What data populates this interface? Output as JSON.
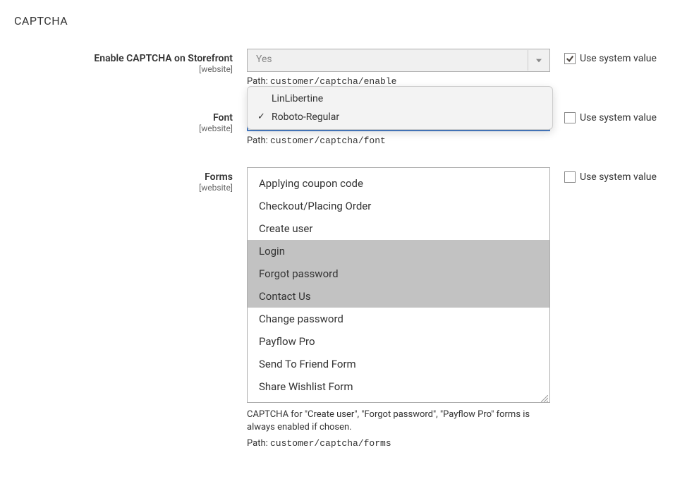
{
  "section": {
    "title": "CAPTCHA"
  },
  "fields": {
    "enable": {
      "label": "Enable CAPTCHA on Storefront",
      "scope": "[website]",
      "value": "Yes",
      "path_label": "Path: ",
      "path_value": "customer/captcha/enable",
      "use_system": true,
      "use_system_label": "Use system value"
    },
    "font": {
      "label": "Font",
      "scope": "[website]",
      "options": [
        {
          "label": "LinLibertine",
          "selected": false
        },
        {
          "label": "Roboto-Regular",
          "selected": true
        }
      ],
      "path_label": "Path: ",
      "path_value": "customer/captcha/font",
      "use_system": false,
      "use_system_label": "Use system value"
    },
    "forms": {
      "label": "Forms",
      "scope": "[website]",
      "options": [
        {
          "label": "Applying coupon code",
          "selected": false
        },
        {
          "label": "Checkout/Placing Order",
          "selected": false
        },
        {
          "label": "Create user",
          "selected": false
        },
        {
          "label": "Login",
          "selected": true
        },
        {
          "label": "Forgot password",
          "selected": true
        },
        {
          "label": "Contact Us",
          "selected": true
        },
        {
          "label": "Change password",
          "selected": false
        },
        {
          "label": "Payflow Pro",
          "selected": false
        },
        {
          "label": "Send To Friend Form",
          "selected": false
        },
        {
          "label": "Share Wishlist Form",
          "selected": false
        }
      ],
      "help_text": "CAPTCHA for \"Create user\", \"Forgot password\", \"Payflow Pro\" forms is always enabled if chosen.",
      "path_label": "Path: ",
      "path_value": "customer/captcha/forms",
      "use_system": false,
      "use_system_label": "Use system value"
    }
  }
}
